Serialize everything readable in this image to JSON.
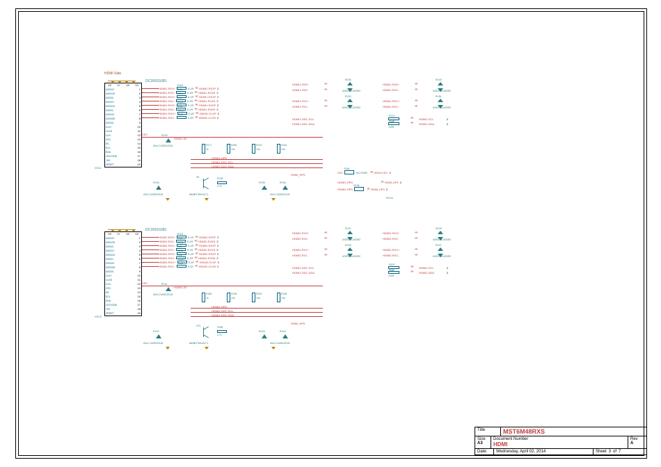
{
  "hdmi_side_label": "HDMI Side",
  "connector": {
    "refdes_top": "DC1R019JB1",
    "refdes_bottom": "DC1R019JB1",
    "xs_top": "XS11",
    "xs_bottom": "XS13",
    "top_pins": [
      "19",
      "17",
      "15",
      "13"
    ],
    "rows": [
      {
        "name": "DATA2+",
        "pin": "1"
      },
      {
        "name": "DATA2S",
        "pin": "2"
      },
      {
        "name": "DATA2-",
        "pin": "3"
      },
      {
        "name": "DATA1+",
        "pin": "4"
      },
      {
        "name": "DATA1S",
        "pin": "5"
      },
      {
        "name": "DATA1-",
        "pin": "6"
      },
      {
        "name": "DATA0+",
        "pin": "7"
      },
      {
        "name": "DATA0S",
        "pin": "8"
      },
      {
        "name": "DATA0-",
        "pin": "9"
      },
      {
        "name": "CLK+",
        "pin": "10"
      },
      {
        "name": "CLKS",
        "pin": "11"
      },
      {
        "name": "CLK-",
        "pin": "12"
      },
      {
        "name": "CEC",
        "pin": "13"
      },
      {
        "name": "NC",
        "pin": "14"
      },
      {
        "name": "SCL",
        "pin": "15"
      },
      {
        "name": "SDA",
        "pin": "16"
      },
      {
        "name": "CEC/GND",
        "pin": "17"
      },
      {
        "name": "+5V",
        "pin": "18"
      },
      {
        "name": "HPDET",
        "pin": "19"
      }
    ]
  },
  "lanes1": [
    {
      "sig1": "HDMI1-RX2+",
      "ref": "R162",
      "val": "5.1R",
      "sig2": "HDMI1-RX2P",
      "suf": "2"
    },
    {
      "sig1": "HDMI1-RX2-",
      "ref": "R210",
      "val": "5.1R",
      "sig2": "HDMI1-RX2N",
      "suf": "2"
    },
    {
      "sig1": "HDMI1-RX1+",
      "ref": "R211",
      "val": "5.1R",
      "sig2": "HDMI1-RX1P",
      "suf": "2"
    },
    {
      "sig1": "HDMI1-RX1-",
      "ref": "R209",
      "val": "5.1R",
      "sig2": "HDMI1-RX1N",
      "suf": "2"
    },
    {
      "sig1": "HDMI1-RX0+",
      "ref": "R212",
      "val": "5.1R",
      "sig2": "HDMI1-RX0P",
      "suf": "2"
    },
    {
      "sig1": "HDMI1-RX0-",
      "ref": "R215",
      "val": "5.1R",
      "sig2": "HDMI1-RX0N",
      "suf": "2"
    },
    {
      "sig1": "HDMI1-RXC+",
      "ref": "R214",
      "val": "5.1R",
      "sig2": "HDMI1-CLKP",
      "suf": "2"
    },
    {
      "sig1": "HDMI1-RXC-",
      "ref": "R161",
      "val": "5.1R",
      "sig2": "HDMI1-CLKN",
      "suf": "2"
    }
  ],
  "lanes2": [
    {
      "sig1": "HDMI2-RX2+",
      "ref": "R163",
      "val": "5.1R",
      "sig2": "HDMI2-RX2P",
      "suf": "2"
    },
    {
      "sig1": "HDMI2-RX2-",
      "ref": "R190",
      "val": "5.1R",
      "sig2": "HDMI2-RX2N",
      "suf": "2"
    },
    {
      "sig1": "HDMI2-RX1+",
      "ref": "R191",
      "val": "5.1R",
      "sig2": "HDMI2-RX1P",
      "suf": "2"
    },
    {
      "sig1": "HDMI2-RX1-",
      "ref": "R130",
      "val": "5.1R",
      "sig2": "HDMI2-RX1N",
      "suf": "2"
    },
    {
      "sig1": "HDMI2-RX0+",
      "ref": "R285",
      "val": "5.1R",
      "sig2": "HDMI2-RX0P",
      "suf": "2"
    },
    {
      "sig1": "HDMI2-RX0-",
      "ref": "R182",
      "val": "5.1R",
      "sig2": "HDMI2-RX0N",
      "suf": "2"
    },
    {
      "sig1": "HDMI2-RXC+",
      "ref": "R192",
      "val": "5.1R",
      "sig2": "HDMI2-CLKP",
      "suf": "2"
    },
    {
      "sig1": "HDMI2-RXC-",
      "ref": "R143",
      "val": "5.1R",
      "sig2": "HDMI2-CLKN",
      "suf": "2"
    }
  ],
  "rv1_left": [
    {
      "sig": "HDMI1-RX2+",
      "ref": "RV30",
      "pn": "ASES12U020R2"
    },
    {
      "sig": "HDMI1-RX2-",
      "ref": "RV31",
      "pn": "ASES12U020R2"
    },
    {
      "sig": "HDMI1-RX1+",
      "ref": "RV32",
      "pn": "ASES12U020R2"
    },
    {
      "sig": "HDMI1-RX1-",
      "ref": "RV33",
      "pn": "ASES12U020R2"
    }
  ],
  "rv1_right": [
    {
      "sig": "HDMI1-RX0+",
      "ref": "RV49",
      "pn": "ASES12U020R2"
    },
    {
      "sig": "HDMI1-RX0-",
      "ref": "RV50",
      "pn": "ASES12U020R2"
    },
    {
      "sig": "HDMI1-RXC+",
      "ref": "RV51",
      "pn": "ASES12U020R2"
    },
    {
      "sig": "HDMI1-RXC-",
      "ref": "RV52",
      "pn": "ASES12U020R2"
    }
  ],
  "rv2_left": [
    {
      "sig": "HDMI2-RX2+",
      "ref": "RV37",
      "pn": "ASES12U020R2"
    },
    {
      "sig": "HDMI2-RX2-",
      "ref": "RV38",
      "pn": "ASES12U020R2"
    },
    {
      "sig": "HDMI2-RX1+",
      "ref": "RV39",
      "pn": "ASES12U020R2"
    },
    {
      "sig": "HDMI2-RX1-",
      "ref": "RV40",
      "pn": "ASES12U020R2"
    }
  ],
  "rv2_right": [
    {
      "sig": "HDMI2-RX0+",
      "ref": "RV45",
      "pn": "ASES12U020R2"
    },
    {
      "sig": "HDMI2-RX0-",
      "ref": "RV46",
      "pn": "ASES12U020R2"
    },
    {
      "sig": "HDMI2-RXC+",
      "ref": "RV47",
      "pn": "ASES12U020R2"
    },
    {
      "sig": "HDMI2-RXC-",
      "ref": "RV48",
      "pn": "ASES12U020R2"
    }
  ],
  "ddc1": {
    "scl_sig": "HDMI1-DDC-SCL",
    "scl_out": "HDMI1-SCL",
    "suf": "2",
    "sda_sig": "HDMI1-DDC-SDA",
    "sda_out": "HDMI1-SDA",
    "r1": {
      "ref": "R213",
      "val": "100R"
    },
    "r2": {
      "ref": "R216",
      "val": "100R"
    }
  },
  "ddc2": {
    "scl_sig": "HDMI2-DDC-SCL",
    "scl_out": "HDMI2-SCL",
    "suf": "2",
    "sda_sig": "HDMI2-DDC-SDA",
    "sda_out": "HDMI2-SDA",
    "r1": {
      "ref": "R207",
      "val": "100R"
    },
    "r2": {
      "ref": "R147",
      "val": "100R"
    }
  },
  "lower1": {
    "v5": "HDMI1-5V",
    "cec_label": "CEC",
    "rv_cec": {
      "ref": "RV29",
      "pn": "AVLC18S02015"
    },
    "r_arr": [
      {
        "ref": "R177",
        "val": "1k"
      },
      {
        "ref": "R284",
        "val": "10k"
      },
      {
        "ref": "R219",
        "val": "10k"
      },
      {
        "ref": "R164",
        "val": "10k"
      }
    ],
    "hpd": "HDMI1-HPD",
    "scl": "HDMI1-DDC-SCL",
    "sda": "HDMI1-DDC-SDA",
    "rv_hpd": [
      {
        "ref": "RV34",
        "pn": "AVLC18S02015"
      },
      {
        "ref": "RV35",
        "pn": "AVLC18S02015"
      },
      {
        "ref": "RV36",
        "pn": "AVLC18S02015"
      }
    ],
    "rv_hps": {
      "ref": "RV29",
      "sig": "HDMI_HPS"
    },
    "q": {
      "ref": "V6",
      "pn": "MMBT3904LT1"
    },
    "rbase": {
      "ref": "R218",
      "val": "4.7k"
    },
    "dz": {
      "ref": ""
    }
  },
  "lower2": {
    "v5": "HDMI2-5V",
    "cec_label": "CEC",
    "rv_cec": {
      "ref": "RV41",
      "pn": "AVLC18S02015"
    },
    "r_arr": [
      {
        "ref": "R185",
        "val": "1k"
      },
      {
        "ref": "R208",
        "val": "10k"
      },
      {
        "ref": "R915",
        "val": "10k"
      },
      {
        "ref": "R166",
        "val": "10k"
      }
    ],
    "hpd": "HDMI2-HPD",
    "scl": "HDMI2-DDC-SCL",
    "sda": "HDMI2-DDC-SDA",
    "rv_hpd": [
      {
        "ref": "RV42",
        "pn": "AVLC18S02015"
      },
      {
        "ref": "RV43",
        "pn": "AVLC18S02015"
      },
      {
        "ref": "RV44",
        "pn": "AVLC18S02015"
      }
    ],
    "rv_hps": {
      "ref": "",
      "sig": "HDMI_HP5"
    },
    "q": {
      "ref": "V2V",
      "pn": "MMBT3904LT1"
    },
    "rbase": {
      "ref": "R186",
      "val": "4.7k"
    }
  },
  "cec_out": {
    "cec": {
      "sig": "CEC",
      "ref": "R181",
      "val": "NC/100R",
      "out": "HDMI-CEC",
      "suf": "2"
    },
    "rows": [
      {
        "sig": "HDMI1-HPD",
        "out": "HDMI_HP1",
        "suf": "2"
      },
      {
        "sig": "HDMI2-HPD",
        "ref": "R194",
        "out": "HDMI_HP2",
        "suf": "2"
      }
    ],
    "nc": "NC/1k"
  },
  "titleblock": {
    "title_label": "Title",
    "title": "MST6M48RXS",
    "size_label": "Size",
    "size": "A3",
    "docnum_label": "Document Number",
    "docnum": "HDMI",
    "rev_label": "Rev",
    "rev": "A",
    "date_label": "Date:",
    "date": "Wednesday, April 02, 2014",
    "sheet_label": "Sheet",
    "sheet_n": "3",
    "sheet_of": "of",
    "sheet_total": "7"
  }
}
